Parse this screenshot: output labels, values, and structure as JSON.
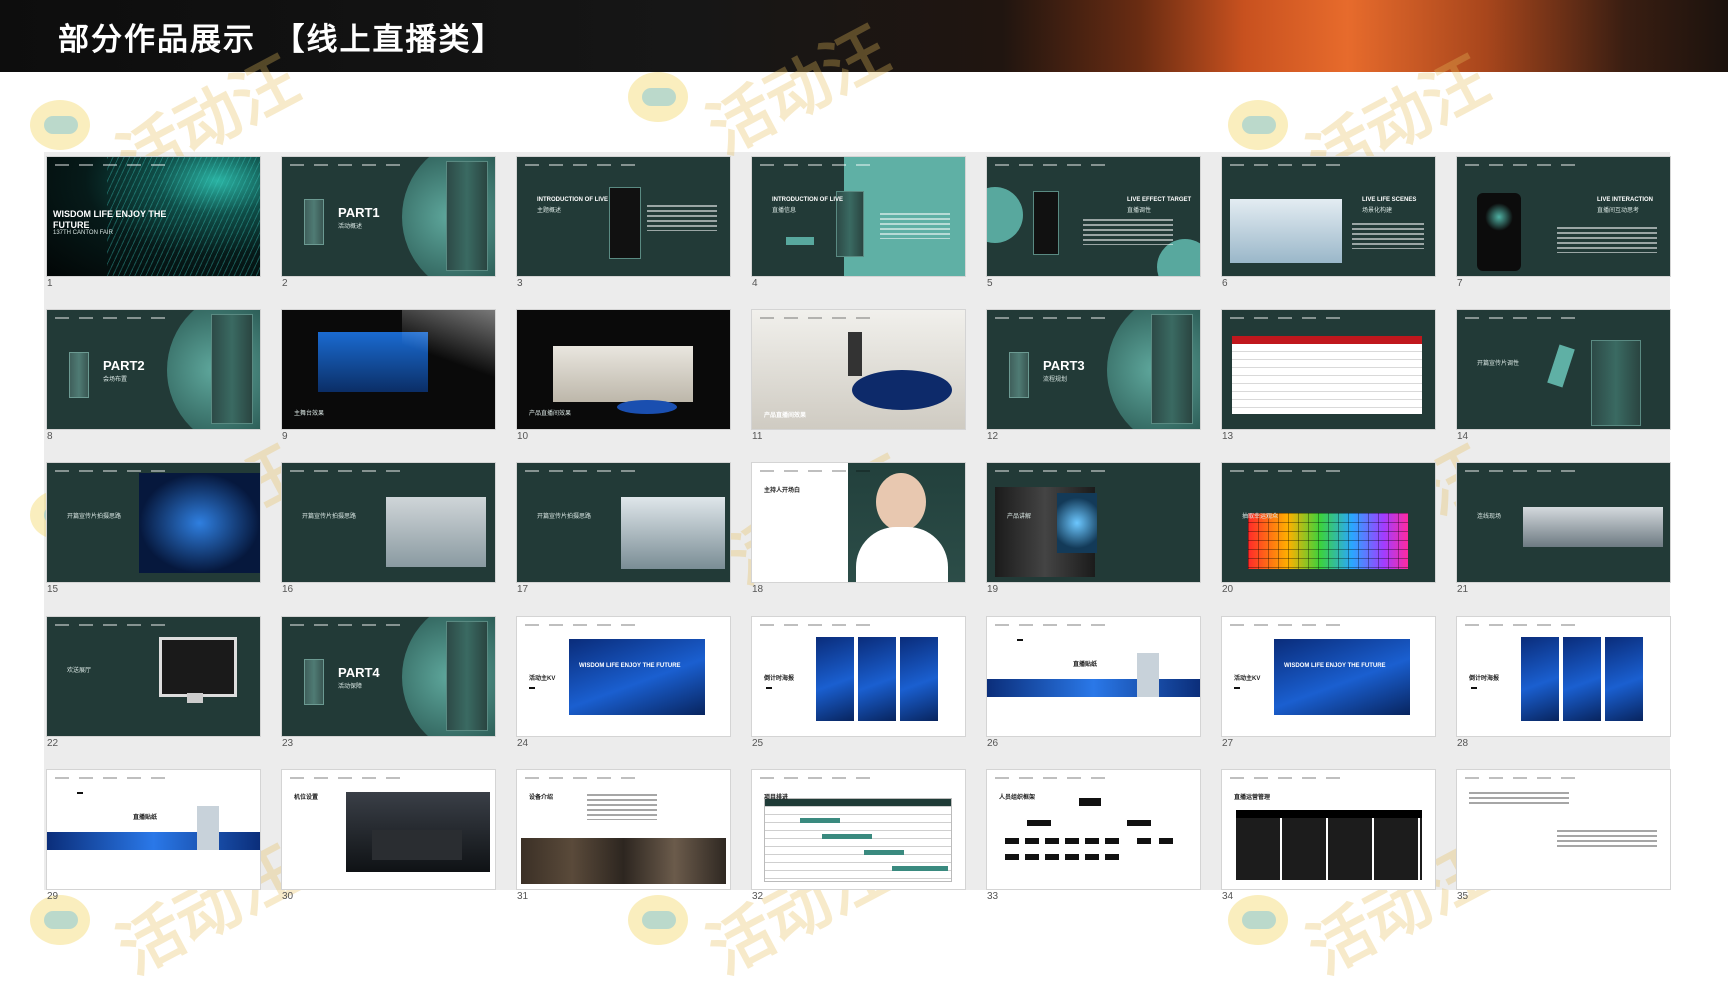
{
  "header": {
    "title": "部分作品展示　【线上直播类】"
  },
  "watermark": {
    "text": "活动汪"
  },
  "slides": [
    {
      "num": "1",
      "title": "WISDOM LIFE ENJOY THE FUTURE",
      "sub": "137TH CANTON FAIR"
    },
    {
      "num": "2",
      "title": "PART1",
      "sub": "活动概述"
    },
    {
      "num": "3",
      "title": "INTRODUCTION OF LIVE",
      "sub": "主题概述"
    },
    {
      "num": "4",
      "title": "INTRODUCTION OF LIVE",
      "sub": "直播信息"
    },
    {
      "num": "5",
      "title": "LIVE EFFECT TARGET",
      "sub": "直播调性"
    },
    {
      "num": "6",
      "title": "LIVE LIFE SCENES",
      "sub": "场景化构建"
    },
    {
      "num": "7",
      "title": "LIVE INTERACTION",
      "sub": "直播间互动思考"
    },
    {
      "num": "8",
      "title": "PART2",
      "sub": "会场布置"
    },
    {
      "num": "9",
      "title": "",
      "sub": "主舞台效果"
    },
    {
      "num": "10",
      "title": "",
      "sub": "产品直播间效果"
    },
    {
      "num": "11",
      "title": "",
      "sub": "产品直播间效果"
    },
    {
      "num": "12",
      "title": "PART3",
      "sub": "流程规划"
    },
    {
      "num": "13",
      "title": "",
      "sub": ""
    },
    {
      "num": "14",
      "title": "",
      "sub": "开篇宣传片调性"
    },
    {
      "num": "15",
      "title": "",
      "sub": "开篇宣传片拍摄思路"
    },
    {
      "num": "16",
      "title": "",
      "sub": "开篇宣传片拍摄思路"
    },
    {
      "num": "17",
      "title": "",
      "sub": "开篇宣传片拍摄思路"
    },
    {
      "num": "18",
      "title": "",
      "sub": "主持人开场白"
    },
    {
      "num": "19",
      "title": "",
      "sub": "产品讲解"
    },
    {
      "num": "20",
      "title": "",
      "sub": "抽取幸运观众"
    },
    {
      "num": "21",
      "title": "",
      "sub": "连线现场"
    },
    {
      "num": "22",
      "title": "",
      "sub": "欢送展厅"
    },
    {
      "num": "23",
      "title": "PART4",
      "sub": "活动保障"
    },
    {
      "num": "24",
      "title": "WISDOM LIFE ENJOY THE FUTURE",
      "sub": "活动主KV"
    },
    {
      "num": "25",
      "title": "",
      "sub": "倒计时海报"
    },
    {
      "num": "26",
      "title": "",
      "sub": "直播贴纸"
    },
    {
      "num": "27",
      "title": "WISDOM LIFE ENJOY THE FUTURE",
      "sub": "活动主KV"
    },
    {
      "num": "28",
      "title": "",
      "sub": "倒计时海报"
    },
    {
      "num": "29",
      "title": "",
      "sub": "直播贴纸"
    },
    {
      "num": "30",
      "title": "",
      "sub": "机位设置"
    },
    {
      "num": "31",
      "title": "",
      "sub": "设备介绍"
    },
    {
      "num": "32",
      "title": "",
      "sub": "项目排进"
    },
    {
      "num": "33",
      "title": "",
      "sub": "人员组织框架"
    },
    {
      "num": "34",
      "title": "",
      "sub": "直播运营管理"
    },
    {
      "num": "35",
      "title": "",
      "sub": ""
    }
  ]
}
